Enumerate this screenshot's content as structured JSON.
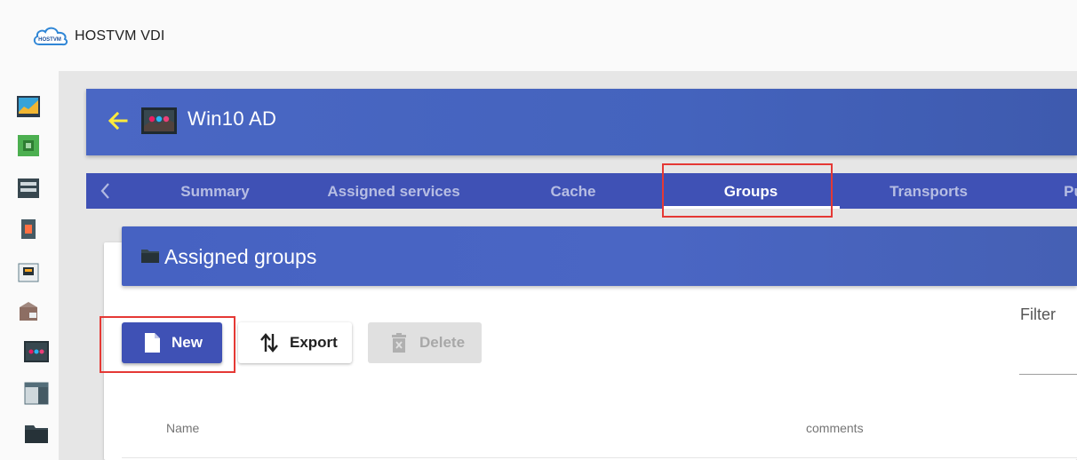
{
  "app": {
    "title": "HOSTVM VDI",
    "logo_text": "HOSTVM"
  },
  "sidebar": {
    "items": [
      {
        "name": "dashboard-icon"
      },
      {
        "name": "services-icon"
      },
      {
        "name": "servers-icon"
      },
      {
        "name": "authenticators-icon"
      },
      {
        "name": "connectivity-icon"
      },
      {
        "name": "pools-icon"
      },
      {
        "name": "service-pool-icon"
      },
      {
        "name": "meta-pool-icon"
      },
      {
        "name": "groups-icon"
      }
    ]
  },
  "header": {
    "title": "Win10 AD"
  },
  "tabs": [
    {
      "label": "Summary",
      "active": false
    },
    {
      "label": "Assigned services",
      "active": false
    },
    {
      "label": "Cache",
      "active": false
    },
    {
      "label": "Groups",
      "active": true
    },
    {
      "label": "Transports",
      "active": false
    },
    {
      "label": "Pu",
      "active": false
    }
  ],
  "panel": {
    "title": "Assigned groups"
  },
  "toolbar": {
    "new_label": "New",
    "export_label": "Export",
    "delete_label": "Delete"
  },
  "filter": {
    "label": "Filter",
    "value": ""
  },
  "table": {
    "columns": [
      "Name",
      "comments"
    ]
  },
  "colors": {
    "primary": "#3f51b5",
    "header_gradient": "#4a67c4",
    "back_arrow": "#ffeb3b",
    "highlight": "#e53935"
  }
}
